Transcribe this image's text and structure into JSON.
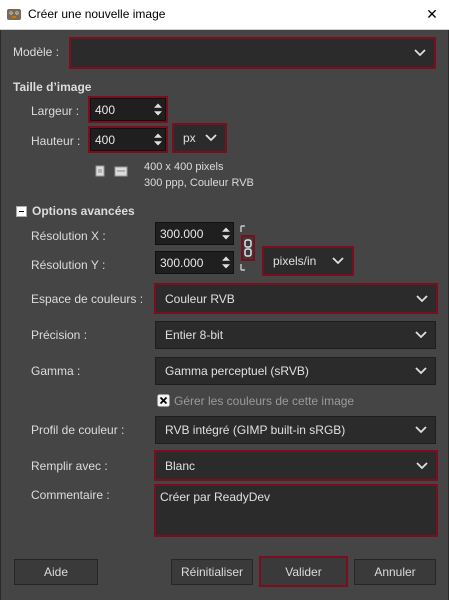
{
  "window": {
    "title": "Créer une nouvelle image",
    "close_glyph": "✕"
  },
  "template": {
    "label": "Modèle :",
    "value": ""
  },
  "image_size": {
    "section": "Taille d’image",
    "width_label": "Largeur :",
    "width_value": "400",
    "height_label": "Hauteur :",
    "height_value": "400",
    "unit": "px",
    "info_line1": "400 x 400 pixels",
    "info_line2": "300 ppp, Couleur RVB"
  },
  "advanced": {
    "section": "Options avancées",
    "res_x_label": "Résolution X :",
    "res_x_value": "300.000",
    "res_y_label": "Résolution Y :",
    "res_y_value": "300.000",
    "res_unit": "pixels/in",
    "colorspace_label": "Espace de couleurs :",
    "colorspace_value": "Couleur RVB",
    "precision_label": "Précision :",
    "precision_value": "Entier 8-bit",
    "gamma_label": "Gamma :",
    "gamma_value": "Gamma perceptuel (sRVB)",
    "manage_colors_label": "Gérer les couleurs de cette image",
    "profile_label": "Profil de couleur :",
    "profile_value": "RVB intégré (GIMP built-in sRGB)",
    "fill_label": "Remplir avec :",
    "fill_value": "Blanc",
    "comment_label": "Commentaire :",
    "comment_value": "Créer par ReadyDev"
  },
  "buttons": {
    "help": "Aide",
    "reset": "Réinitialiser",
    "ok": "Valider",
    "cancel": "Annuler"
  },
  "colors": {
    "background": "#454545",
    "field": "#2b2b2b",
    "highlight": "#7a0d1e"
  }
}
